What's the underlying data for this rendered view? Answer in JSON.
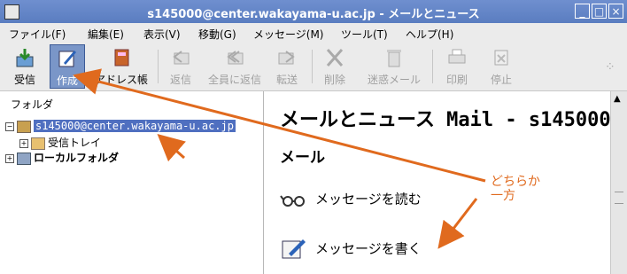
{
  "window": {
    "title": "s145000@center.wakayama-u.ac.jp - メールとニュース"
  },
  "menu": [
    "ファイル(F)",
    "編集(E)",
    "表示(V)",
    "移動(G)",
    "メッセージ(M)",
    "ツール(T)",
    "ヘルプ(H)"
  ],
  "toolbar": {
    "get": "受信",
    "write": "作成",
    "address": "アドレス帳",
    "reply": "返信",
    "reply_all": "全員に返信",
    "forward": "転送",
    "delete": "削除",
    "junk": "迷惑メール",
    "print": "印刷",
    "stop": "停止"
  },
  "folders": {
    "header": "フォルダ",
    "account": "s145000@center.wakayama-u.ac.jp",
    "inbox": "受信トレイ",
    "local": "ローカルフォルダ"
  },
  "content": {
    "heading": "メールとニュース Mail - s145000",
    "section": "メール",
    "read": "メッセージを読む",
    "write": "メッセージを書く"
  },
  "annotation": {
    "line1": "どちらか",
    "line2": "一方"
  },
  "colors": {
    "title_bar": "#5a7dc0",
    "selection": "#4f6fc0",
    "annotation": "#e06a1e"
  }
}
